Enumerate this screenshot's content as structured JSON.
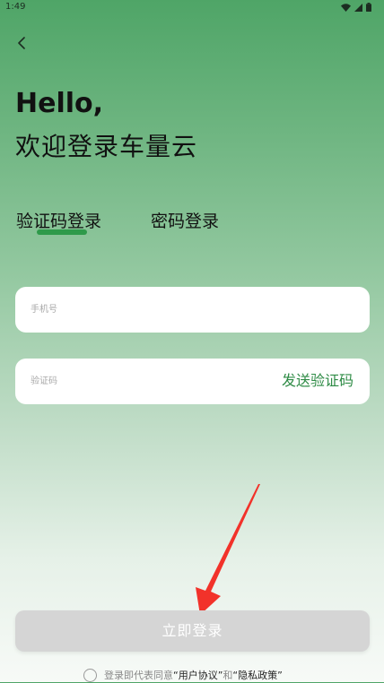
{
  "status_bar": {
    "time": "1:49",
    "icons": [
      "wifi-icon",
      "signal-icon",
      "battery-icon"
    ]
  },
  "header": {
    "back_icon": "chevron-left-icon",
    "greeting": "Hello,",
    "welcome": "欢迎登录车量云"
  },
  "tabs": [
    {
      "label": "验证码登录",
      "active": true
    },
    {
      "label": "密码登录",
      "active": false
    }
  ],
  "form": {
    "phone": {
      "placeholder": "手机号",
      "value": ""
    },
    "code": {
      "placeholder": "验证码",
      "value": ""
    },
    "send_code_label": "发送验证码"
  },
  "login_button": {
    "label": "立即登录",
    "enabled": false
  },
  "agreement": {
    "checked": false,
    "prefix": "登录即代表同意",
    "user_agreement": "“用户协议”",
    "conjunction": "和",
    "privacy_policy": "“隐私政策”"
  },
  "colors": {
    "accent": "#2e8b45",
    "tab_indicator": "#2e9a4a",
    "annotation_arrow": "#f2322a",
    "disabled_button": "#d5d5d5"
  }
}
